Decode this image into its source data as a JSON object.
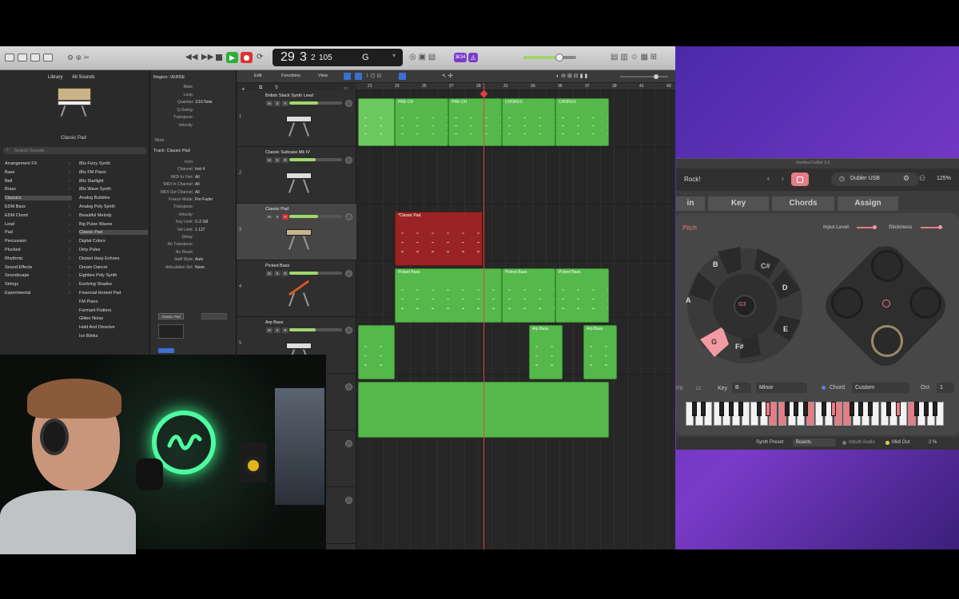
{
  "control_bar": {
    "lcd_bar": "29",
    "lcd_beat": "3",
    "lcd_div": "2",
    "lcd_tempo": "105",
    "lcd_key": "G",
    "count_badge": "⌘34"
  },
  "library": {
    "title": "Library",
    "filter": "All Sounds",
    "patch_name": "Classic Pad",
    "search_placeholder": "Search Sounds",
    "categories": [
      "Arrangement FX",
      "Bass",
      "Bell",
      "Brass",
      "Classics",
      "EDM Bass",
      "EDM Chord",
      "Lead",
      "Pad",
      "Percussion",
      "Plucked",
      "Rhythmic",
      "Sound Effects",
      "Soundscape",
      "Strings",
      "Experimental"
    ],
    "patches": [
      "80s Fizzy Synth",
      "80s FM Piano",
      "80s Starlight",
      "80s Wave Synth",
      "Analog Bubbles",
      "Analog Poly Synth",
      "Beautiful Melody",
      "Big Pulse Waves",
      "Classic Pad",
      "Digital Colors",
      "Dirty Pulse",
      "Distant Harp Echoes",
      "Dream Dancer",
      "Eighties Poly Synth",
      "Evolving Shades",
      "Financial Honest Pad",
      "FM Piano",
      "Formant Flutters",
      "Glitter Noise",
      "Hold And Dissolve",
      "Ice Blinks"
    ]
  },
  "inspector": {
    "region_label": "Region: VERSE",
    "rows": [
      {
        "k": "Mute:",
        "v": ""
      },
      {
        "k": "Loop:",
        "v": ""
      },
      {
        "k": "Quantize",
        "v": "1/16 Note"
      },
      {
        "k": "Q-Swing:",
        "v": ""
      },
      {
        "k": "Transpose:",
        "v": ""
      },
      {
        "k": "Velocity:",
        "v": ""
      }
    ],
    "more": "More",
    "track_label": "Track: Classic Pad",
    "track_rows": [
      {
        "k": "Icon:",
        "v": ""
      },
      {
        "k": "Channel:",
        "v": "Inst 4"
      },
      {
        "k": "MIDI In Port:",
        "v": "All"
      },
      {
        "k": "MIDI In Channel:",
        "v": "All"
      },
      {
        "k": "MIDI Out Channel:",
        "v": "All"
      },
      {
        "k": "Freeze Mode:",
        "v": "Pre Fader"
      },
      {
        "k": "Transpose:",
        "v": ""
      },
      {
        "k": "Velocity:",
        "v": ""
      },
      {
        "k": "Key Limit:",
        "v": "C-2  G8"
      },
      {
        "k": "Vel Limit:",
        "v": "1  127"
      },
      {
        "k": "Delay:",
        "v": ""
      },
      {
        "k": "No Transpose:",
        "v": ""
      },
      {
        "k": "No Reset:",
        "v": ""
      },
      {
        "k": "Staff Style:",
        "v": "Auto"
      },
      {
        "k": "Articulation Set:",
        "v": "None"
      }
    ],
    "strip_name": "Classic Pad"
  },
  "workspace": {
    "menus": [
      "Edit",
      "Functions",
      "View"
    ],
    "ruler": [
      "21",
      "23",
      "25",
      "27",
      "29",
      "31",
      "33",
      "35",
      "37",
      "39",
      "41",
      "43"
    ],
    "tracks": [
      {
        "num": "1",
        "name": "British Stack Synth Lead",
        "fill": 0.55
      },
      {
        "num": "2",
        "name": "Classic Suitcase Mk IV",
        "fill": 0.5
      },
      {
        "num": "3",
        "name": "Classic Pad",
        "fill": 0.55
      },
      {
        "num": "4",
        "name": "Picked Bass",
        "fill": 0.55
      },
      {
        "num": "5",
        "name": "Arp Bass",
        "fill": 0.5
      }
    ],
    "regions": {
      "r1a": "",
      "r1b": "PRE-CH",
      "r1c": "PRE-CH",
      "r1d": "CHORUS",
      "r1e": "CHORUS",
      "r3": "*Classic Pad",
      "r4a": "Picked Bass",
      "r4b": "Picked Bass",
      "r4c": "Picked Bass",
      "r5b": "Arp Bass",
      "r5c": "Arp Bass"
    }
  },
  "plugin": {
    "title": "Vochlea Dubler 2.0",
    "preset": "Rock!",
    "device": "Dubler USB",
    "zoom": "125%",
    "tabs": [
      "in",
      "Key",
      "Chords",
      "Assign"
    ],
    "pitch_label": "Pitch",
    "input_level": "Input Level",
    "stickiness": "Stickiness",
    "wheel_notes": [
      "B",
      "C#",
      "D",
      "E",
      "F#",
      "G",
      "A"
    ],
    "center_note": "G3",
    "key_label": "Key",
    "key_value": "B",
    "scale_value": "Minor",
    "chord_label": "Chord",
    "chord_value": "Custom",
    "oct_label": "Oct",
    "oct_value": "1",
    "pb_label": "PB",
    "pb_value": "12",
    "synth_preset_label": "Synth Preset",
    "synth_preset_value": "Boards",
    "inbuilt_audio": "Inbuilt Audio",
    "midi_out": "Midi Out",
    "footer_value": "2 %"
  },
  "colors": {
    "region_green": "#55b84a",
    "region_red": "#9a2424",
    "accent_pink": "#e57c86",
    "purple_bg": "#6a35b8"
  }
}
